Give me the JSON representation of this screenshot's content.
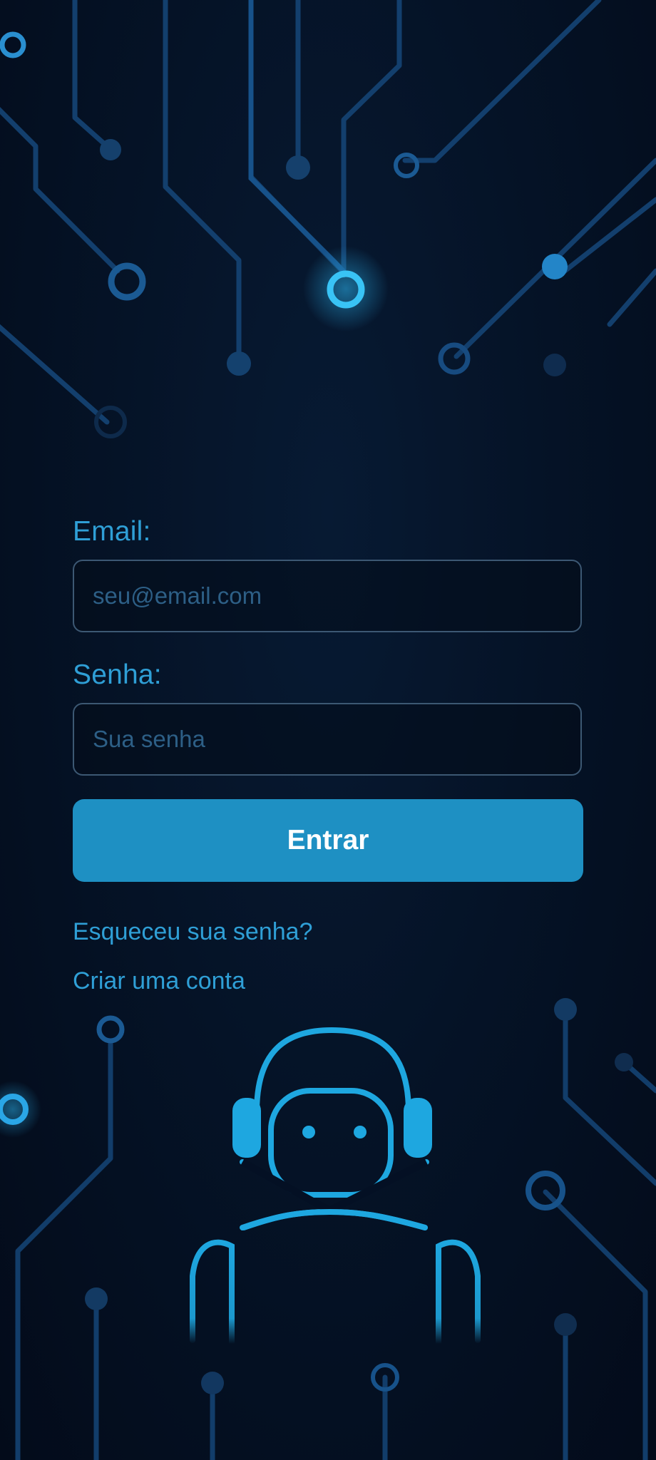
{
  "login_form": {
    "email_label": "Email:",
    "email_placeholder": "seu@email.com",
    "password_label": "Senha:",
    "password_placeholder": "Sua senha",
    "submit_label": "Entrar"
  },
  "links": {
    "forgot_password": "Esqueceu sua senha?",
    "create_account": "Criar uma conta"
  },
  "theme": {
    "background": "#041024",
    "accent": "#1e90c3",
    "label_color": "#2f9fd6",
    "circuit_color": "#1a5fa0"
  },
  "icons": [
    "circuit-board-icon",
    "robot-headset-icon"
  ]
}
